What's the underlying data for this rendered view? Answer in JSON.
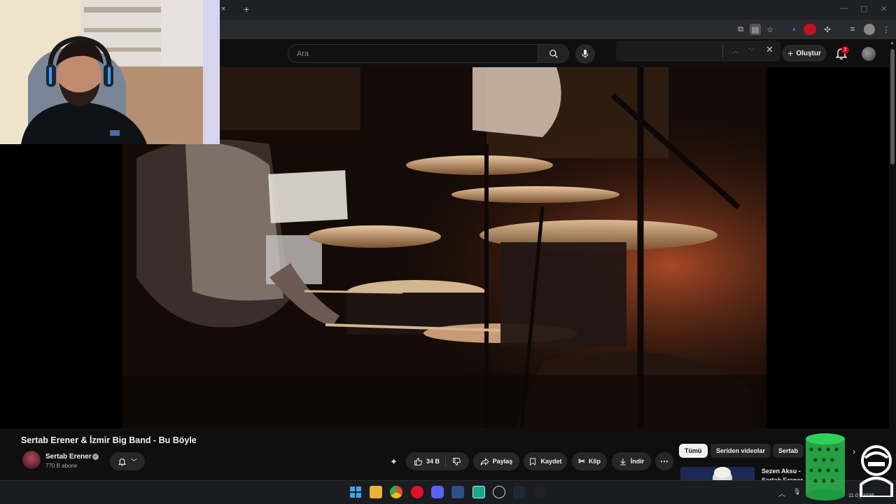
{
  "browser": {
    "tab_close": "×",
    "new_tab": "+",
    "win_controls": [
      "—",
      "▢",
      "✕"
    ]
  },
  "youtube": {
    "search_placeholder": "Ara",
    "create_label": "Oluştur",
    "notification_count": "2"
  },
  "video": {
    "title": "Sertab Erener & İzmir Big Band - Bu Böyle",
    "channel": {
      "name": "Sertab Erener",
      "subscribers": "770 B abone"
    },
    "actions": {
      "likes": "34 B",
      "share": "Paylaş",
      "save": "Kaydet",
      "clip": "Klip",
      "download": "İndir",
      "more": "⋯"
    }
  },
  "sidebar": {
    "chips": [
      "Tümü",
      "Seriden videolar",
      "Sertab"
    ],
    "recommendation": {
      "title": "Sezen Aksu -",
      "channel": "Sertab Erener"
    }
  },
  "taskbar": {
    "date": "11.0_.2026"
  },
  "colors": {
    "accent_red": "#cc0000",
    "background": "#0f0f0f",
    "chip_bg": "#272727"
  }
}
